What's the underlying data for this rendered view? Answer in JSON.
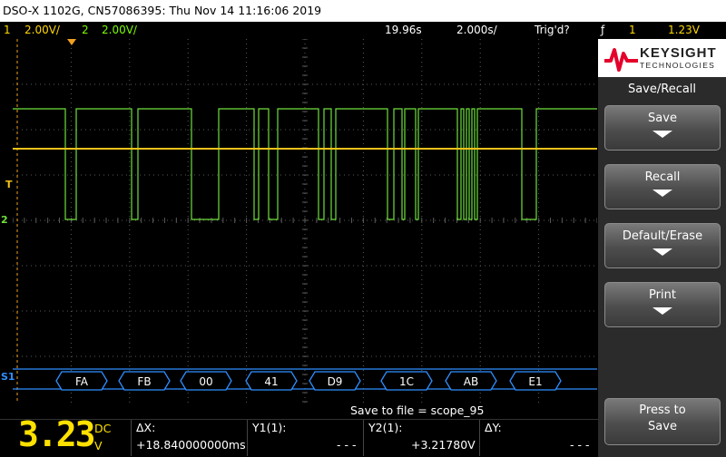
{
  "title_bar": "DSO-X 1102G, CN57086395: Thu Nov 14 11:16:06 2019",
  "status_bar": {
    "ch1_num": "1",
    "ch1_scale": "2.00V/",
    "ch2_num": "2",
    "ch2_scale": "2.00V/",
    "delay": "19.96s",
    "timebase": "2.000s/",
    "trigger_state": "Trig'd?",
    "trigger_slope": "ƒ",
    "trigger_src": "1",
    "trigger_level": "1.23V"
  },
  "colors": {
    "ch1": "#f2c11a",
    "ch2": "#6fe03c",
    "bus": "#2f8fff",
    "grid": "#5a5a5a"
  },
  "markers": {
    "ch2_marker": "2",
    "trigger_marker": "T",
    "serial_marker": "S1"
  },
  "serial_bytes": [
    "FA",
    "FB",
    "00",
    "41",
    "D9",
    "1C",
    "AB",
    "E1"
  ],
  "side_panel": {
    "brand": "KEYSIGHT",
    "brand_sub": "TECHNOLOGIES",
    "menu_title": "Save/Recall",
    "buttons": [
      "Save",
      "Recall",
      "Default/Erase",
      "Print"
    ],
    "press_to_save_1": "Press to",
    "press_to_save_2": "Save"
  },
  "bottom_bar": {
    "save_to_file": "Save to file = scope_95",
    "big_value": "3.23",
    "dc_label": "DC",
    "v_label": "V",
    "dx_label": "ΔX:",
    "dx_value": "+18.840000000ms",
    "y1_label": "Y1(1):",
    "y1_value": "- - -",
    "y2_label": "Y2(1):",
    "y2_value": "+3.21780V",
    "dy_label": "ΔY:",
    "dy_value": "- - -"
  }
}
